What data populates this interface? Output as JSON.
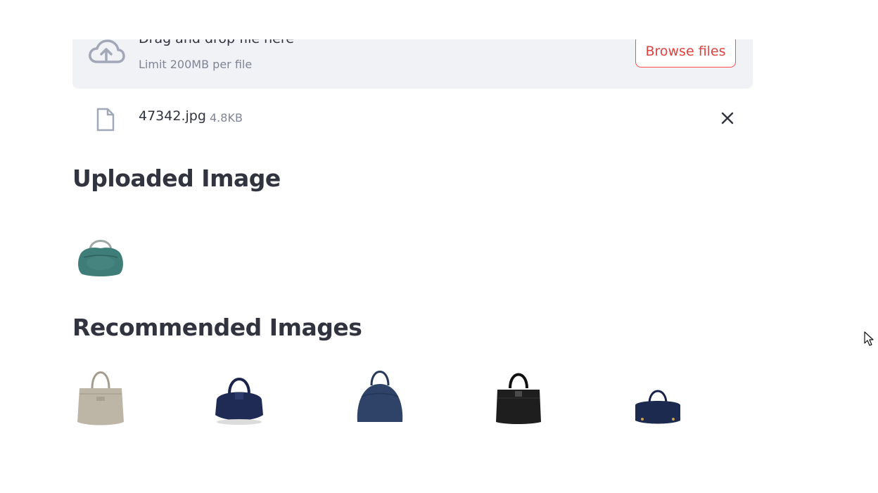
{
  "uploader": {
    "title": "Drag and drop file here",
    "limit": "Limit 200MB per file",
    "browse_label": "Browse files",
    "icon": "cloud-upload-icon"
  },
  "file": {
    "name": "47342.jpg",
    "size": "4.8KB",
    "icon": "file-icon",
    "remove_icon": "close-icon"
  },
  "sections": {
    "uploaded_title": "Uploaded Image",
    "recommended_title": "Recommended Images"
  },
  "uploaded_image": {
    "color": "#3f7d78",
    "style": "hobo"
  },
  "recommended_images": [
    {
      "color": "#bdb6a6",
      "style": "tote"
    },
    {
      "color": "#1f2a55",
      "style": "duffel"
    },
    {
      "color": "#2f4369",
      "style": "dome"
    },
    {
      "color": "#1e1e1e",
      "style": "satchel"
    },
    {
      "color": "#1d2a50",
      "style": "barrel"
    }
  ],
  "colors": {
    "accent": "#ff4b4b",
    "background": "#f0f2f6",
    "text": "#31333f",
    "muted": "#808495"
  }
}
